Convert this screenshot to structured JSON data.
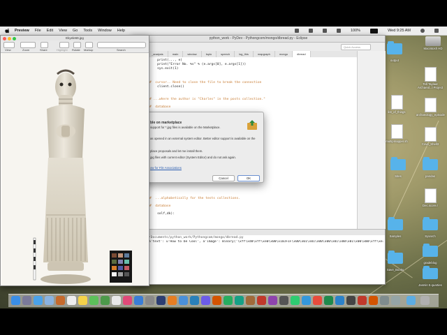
{
  "menubar": {
    "app_name": "Preview",
    "items": [
      "File",
      "Edit",
      "View",
      "Go",
      "Tools",
      "Window",
      "Help"
    ],
    "battery": "100%",
    "clock": "Wed 9:25 AM"
  },
  "eclipse": {
    "title": "python_work - PyDev - Pythongcom/mongo/dbread.py - Eclipse",
    "quick_access": "Quick Access",
    "tabs": [
      "_analysis",
      "main",
      "window",
      "tsplo",
      "speech",
      "log_this",
      "mapgraph",
      "mongo",
      "dbread"
    ],
    "code_lines": [
      {
        "text": "    print(..., e)",
        "kind": "code"
      },
      {
        "text": "    print(\"Error No. %s\" % (e.args[0], e.args[1]))",
        "kind": "code"
      },
      {
        "text": "    sys.exit(1)",
        "kind": "code"
      },
      {
        "text": "#  cursor.. Need to close the file to break the connection",
        "kind": "comment"
      },
      {
        "text": "    client.close()",
        "kind": "code"
      },
      {
        "text": "# ...where the author is \"Charles\" in the posts collection.\"",
        "kind": "comment"
      },
      {
        "text": "#  database",
        "kind": "comment"
      },
      {
        "text": "#  ...alphabetically for the tests collections.",
        "kind": "comment"
      },
      {
        "text": "#  database",
        "kind": "comment"
      },
      {
        "text": "    self,dk):",
        "kind": "code"
      }
    ],
    "console_path": "/Documents/python_work/Pythongcom/mongo/dbread.py",
    "console_output": "a'text': u'How to be Cool', a'image': Binary('\\xff\\xd8\\xff\\xe0\\x00\\x10JFIF\\x00\\x01\\x01\\x00\\x00\\x01\\x00\\x01\\x00\\x00\\xff\\xe1\\x00\\x90"
  },
  "dialog": {
    "title": "ble on marketplace",
    "line1": "support for *.jpg files is available on the Marketplace.",
    "line2": "as opened in an external system editor. Better editor support is available on the",
    "line3": "place proposals and let me install them.",
    "line4": "jpg files with current editor (System Editor) and do not ask again.",
    "link": "ow for File Associations",
    "cancel": "Cancel",
    "ok": "OK"
  },
  "preview": {
    "title": "Ekyele69.jpg",
    "toolbar_labels": [
      "View",
      "Zoom",
      "Share",
      "Highlight",
      "Rotate",
      "Markup",
      "Search"
    ]
  },
  "desktop_icons": [
    {
      "label": "Macintosh HD",
      "type": "hd"
    },
    {
      "label": "output",
      "type": "folder"
    },
    {
      "label": "Tell Taylaut Archaeol...l Project",
      "type": "doc"
    },
    {
      "label": "list_of_things",
      "type": "doc"
    },
    {
      "label": "archaeology_episode",
      "type": "doc"
    },
    {
      "label": "multipmapper.sh",
      "type": "doc"
    },
    {
      "label": "Cove_Shell3",
      "type": "doc"
    },
    {
      "label": "Sites",
      "type": "folder"
    },
    {
      "label": "pandas",
      "type": "folder"
    },
    {
      "label": "Dec.score.r",
      "type": "doc"
    },
    {
      "label": "Samples",
      "type": "folder"
    },
    {
      "label": "Sysarch",
      "type": "folder"
    },
    {
      "label": "Save_Books",
      "type": "folder"
    },
    {
      "label": "gradeblog",
      "type": "folder"
    },
    {
      "label": "Jasmin 5 quarties",
      "type": "folder"
    }
  ]
}
